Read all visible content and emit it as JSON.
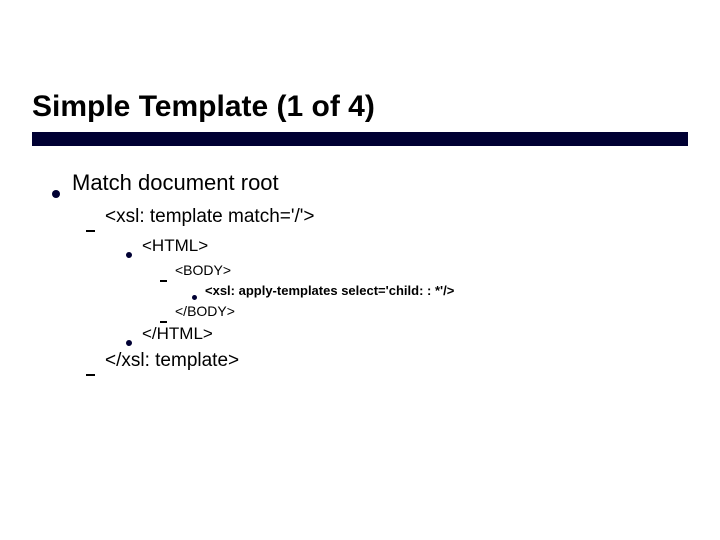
{
  "slide": {
    "title": "Simple Template (1 of 4)",
    "l0": "Match document root",
    "l1_open": "<xsl: template match='/'>",
    "l2_html_open": "<HTML>",
    "l3_body_open": "<BODY>",
    "l4_apply": "<xsl: apply-templates select='child: : *'/>",
    "l3_body_close": "</BODY>",
    "l2_html_close": "</HTML>",
    "l1_close": "</xsl: template>"
  }
}
